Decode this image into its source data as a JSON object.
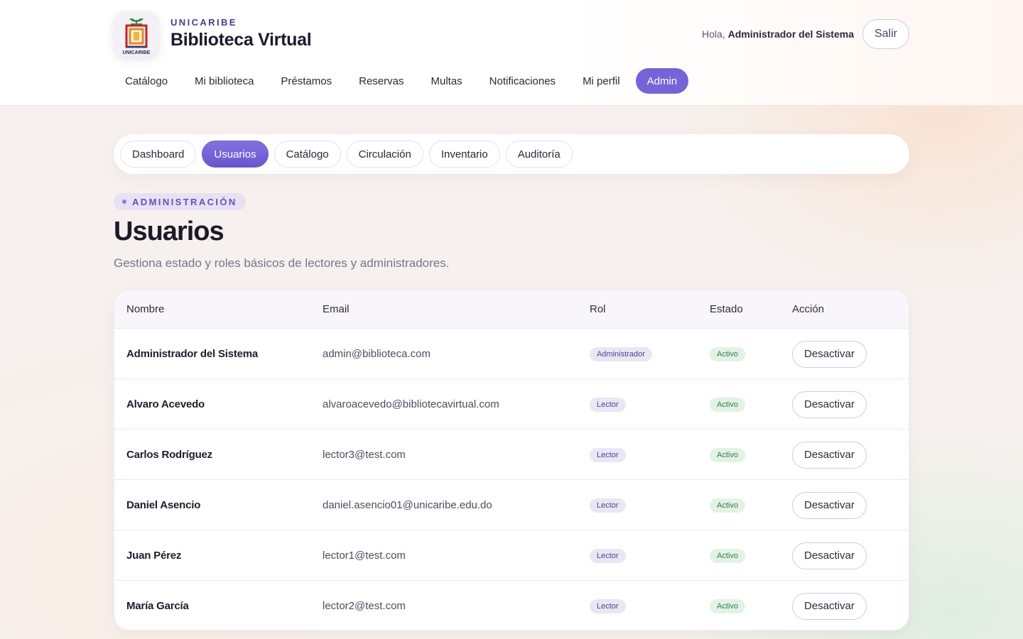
{
  "header": {
    "brand_kicker": "UNICARIBE",
    "brand_title": "Biblioteca Virtual",
    "logo_text": "UNICARIBE",
    "greeting_prefix": "Hola,",
    "user_name": "Administrador del Sistema",
    "logout_label": "Salir"
  },
  "topnav": {
    "items": [
      {
        "label": "Catálogo"
      },
      {
        "label": "Mi biblioteca"
      },
      {
        "label": "Préstamos"
      },
      {
        "label": "Reservas"
      },
      {
        "label": "Multas"
      },
      {
        "label": "Notificaciones"
      },
      {
        "label": "Mi perfil"
      },
      {
        "label": "Admin",
        "active": true
      }
    ]
  },
  "subnav": {
    "items": [
      {
        "label": "Dashboard"
      },
      {
        "label": "Usuarios",
        "active": true
      },
      {
        "label": "Catálogo"
      },
      {
        "label": "Circulación"
      },
      {
        "label": "Inventario"
      },
      {
        "label": "Auditoría"
      }
    ]
  },
  "page": {
    "eyebrow": "ADMINISTRACIÓN",
    "title": "Usuarios",
    "subtitle": "Gestiona estado y roles básicos de lectores y administradores."
  },
  "table": {
    "columns": [
      "Nombre",
      "Email",
      "Rol",
      "Estado",
      "Acción"
    ],
    "rows": [
      {
        "name": "Administrador del Sistema",
        "email": "admin@biblioteca.com",
        "role": "Administrador",
        "state": "Activo",
        "action": "Desactivar"
      },
      {
        "name": "Alvaro Acevedo",
        "email": "alvaroacevedo@bibliotecavirtual.com",
        "role": "Lector",
        "state": "Activo",
        "action": "Desactivar"
      },
      {
        "name": "Carlos Rodríguez",
        "email": "lector3@test.com",
        "role": "Lector",
        "state": "Activo",
        "action": "Desactivar"
      },
      {
        "name": "Daniel Asencio",
        "email": "daniel.asencio01@unicaribe.edu.do",
        "role": "Lector",
        "state": "Activo",
        "action": "Desactivar"
      },
      {
        "name": "Juan Pérez",
        "email": "lector1@test.com",
        "role": "Lector",
        "state": "Activo",
        "action": "Desactivar"
      },
      {
        "name": "María García",
        "email": "lector2@test.com",
        "role": "Lector",
        "state": "Activo",
        "action": "Desactivar"
      }
    ]
  },
  "colors": {
    "accent": "#7763d8",
    "active_badge_bg": "#e2f3e6",
    "active_badge_text": "#2f7a48",
    "role_badge_bg": "#ebe6f4"
  },
  "icons": {
    "logo": "book-frame-logo-icon"
  }
}
